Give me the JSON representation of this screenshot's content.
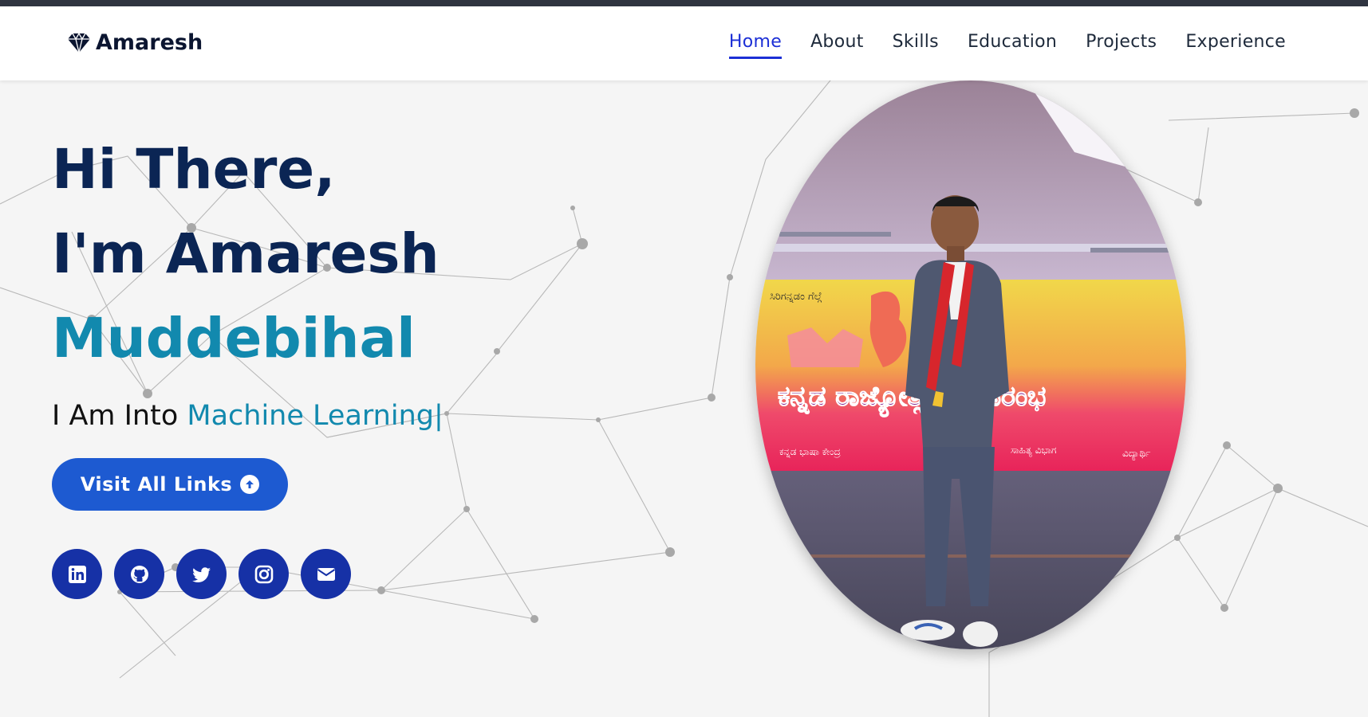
{
  "logo": {
    "text": "Amaresh",
    "icon": "gem-icon"
  },
  "nav": {
    "items": [
      {
        "label": "Home",
        "active": true
      },
      {
        "label": "About"
      },
      {
        "label": "Skills"
      },
      {
        "label": "Education"
      },
      {
        "label": "Projects"
      },
      {
        "label": "Experience"
      }
    ]
  },
  "hero": {
    "greeting": "Hi There,",
    "intro": "I'm Amaresh",
    "surname": "Muddebihal",
    "typed_prefix": "I Am Into ",
    "typed_value": "Machine Learning",
    "cursor": "|"
  },
  "cta": {
    "label": "Visit All Links",
    "icon": "arrow-up-circle-icon"
  },
  "socials": [
    {
      "name": "linkedin-icon"
    },
    {
      "name": "github-icon"
    },
    {
      "name": "twitter-icon"
    },
    {
      "name": "instagram-icon"
    },
    {
      "name": "envelope-icon"
    }
  ],
  "photo": {
    "banner_texts": [
      "ಸಿರಿಗನ್ನಡಂ ಗೆಲ್ಗೆ",
      "ಕನ್ನಡ ರಾಜ್ಯೋತ್ಸವ ಸಮಾರಂಭ",
      "ಕನ್ನಡ ಭಾಷಾ ಕೇಂದ್ರ",
      "ಸಾಹಿತ್ಯ ವಿಭಾಗ",
      "ವಿದ್ಯಾರ್ಥಿ"
    ]
  },
  "colors": {
    "nav_active": "#1c2fd6",
    "heading": "#0b2554",
    "accent": "#1289ae",
    "cta": "#1d5ad1",
    "social": "#1631a6"
  }
}
